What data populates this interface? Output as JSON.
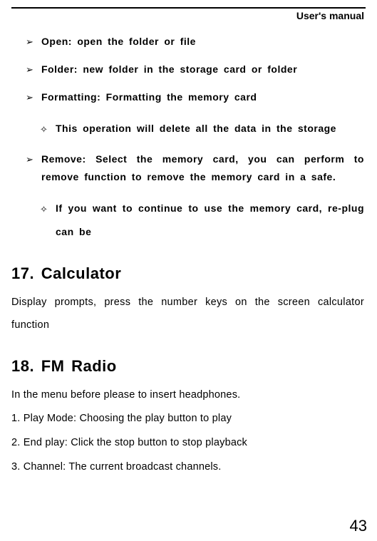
{
  "header": {
    "title": "User's manual"
  },
  "bullets": [
    {
      "text": "Open: open the folder or file"
    },
    {
      "text": "Folder: new folder in the storage card or folder"
    },
    {
      "text": "Formatting: Formatting the memory card"
    }
  ],
  "sub1": {
    "text": "This operation will delete all the data in the storage"
  },
  "bullet4": {
    "text": "Remove: Select the memory card, you can perform to remove function to remove the memory card in a safe."
  },
  "sub2": {
    "text": "If you want to continue to use the memory card, re-plug can be"
  },
  "section17": {
    "heading": "17. Calculator",
    "body": "Display prompts, press the number keys on the screen calculator function"
  },
  "section18": {
    "heading": "18. FM Radio",
    "intro": "In the menu before please to insert headphones.",
    "line1": "1. Play Mode: Choosing the play button to play",
    "line2": "2. End play: Click the stop button to stop playback",
    "line3": "3. Channel: The current broadcast channels."
  },
  "pageNumber": "43",
  "icons": {
    "arrow": "➢",
    "diamond": "✧"
  }
}
